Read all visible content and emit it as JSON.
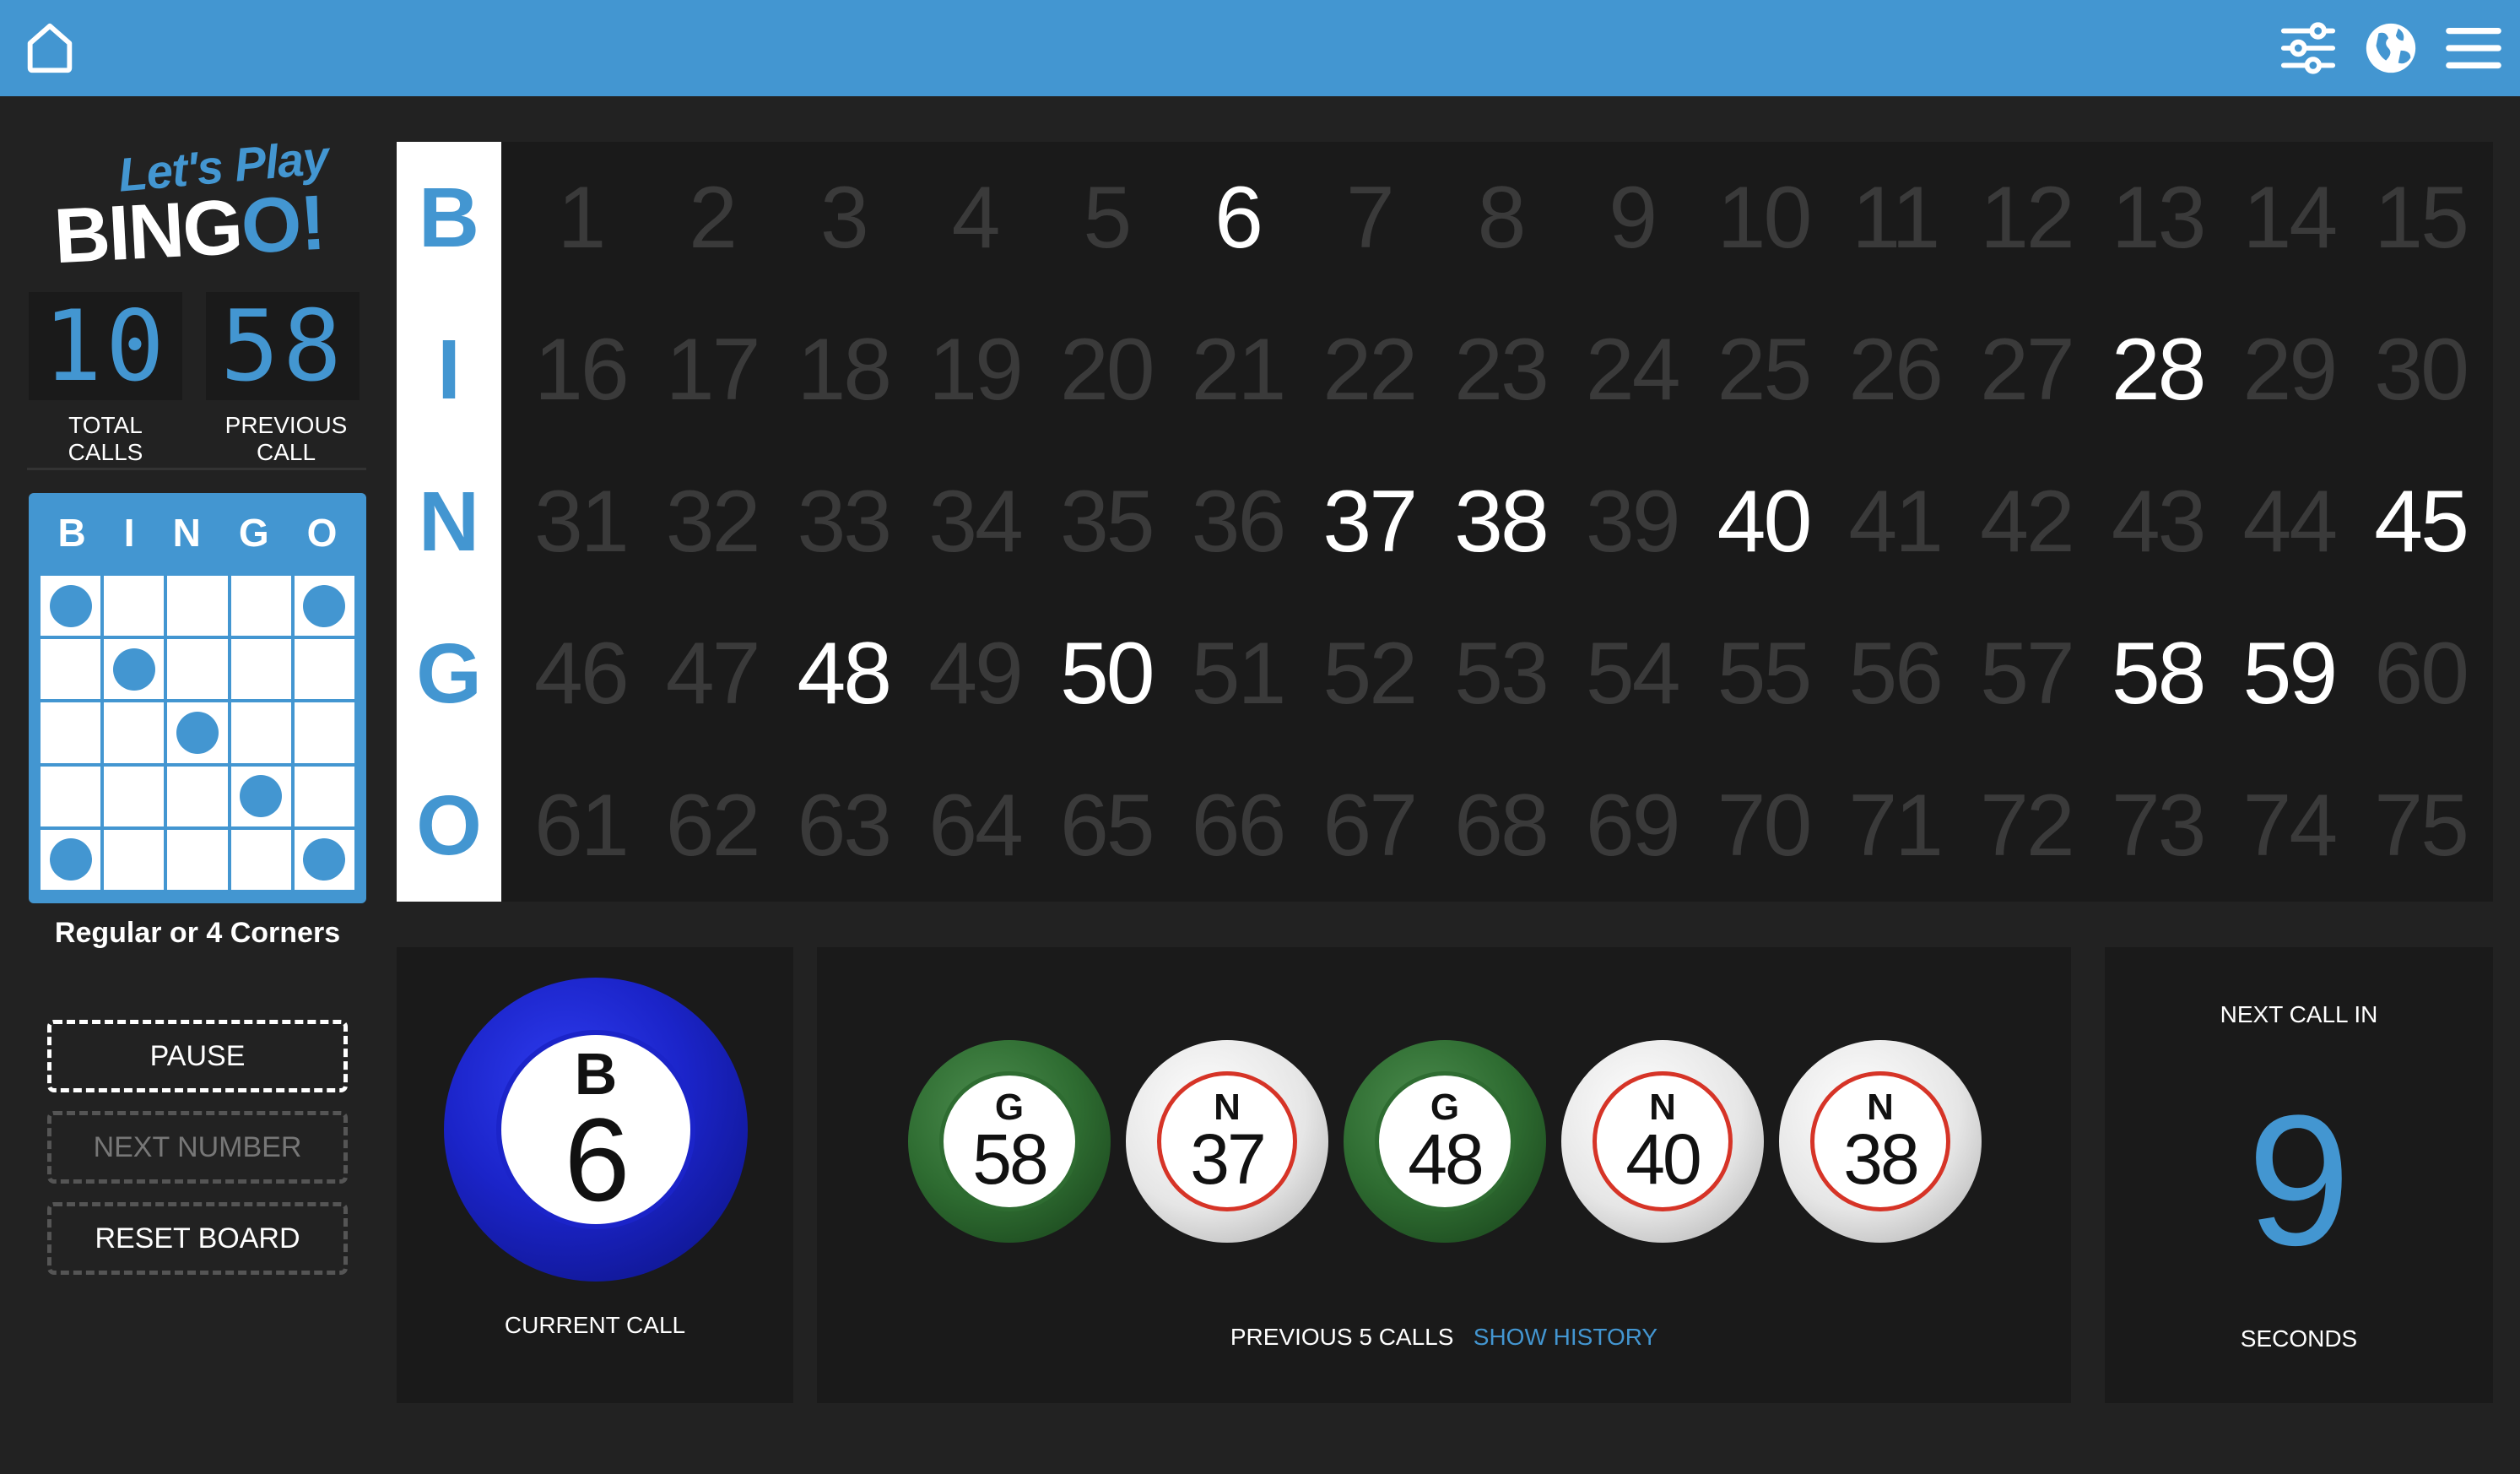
{
  "topbar": {
    "icons": [
      "home-icon",
      "settings-sliders-icon",
      "globe-icon",
      "menu-icon"
    ]
  },
  "logo": {
    "line1": "Let's Play",
    "line2a": "BING",
    "line2b": "O!"
  },
  "stats": {
    "total_calls": "10",
    "total_calls_label": "TOTAL CALLS",
    "previous_call": "58",
    "previous_call_label": "PREVIOUS CALL"
  },
  "pattern": {
    "header": [
      "B",
      "I",
      "N",
      "G",
      "O"
    ],
    "marked": [
      0,
      4,
      6,
      12,
      18,
      20,
      24
    ],
    "name": "Regular or 4 Corners"
  },
  "buttons": {
    "pause": "PAUSE",
    "next_number": "NEXT NUMBER",
    "reset_board": "RESET BOARD"
  },
  "board": {
    "letters": [
      "B",
      "I",
      "N",
      "G",
      "O"
    ],
    "called_numbers": [
      6,
      28,
      37,
      38,
      40,
      45,
      48,
      50,
      58,
      59
    ]
  },
  "current_call": {
    "letter": "B",
    "number": "6",
    "label": "CURRENT CALL"
  },
  "previous_calls": {
    "label": "PREVIOUS 5 CALLS",
    "link": "SHOW HISTORY",
    "balls": [
      {
        "letter": "G",
        "number": "58",
        "color": "green"
      },
      {
        "letter": "N",
        "number": "37",
        "color": "white"
      },
      {
        "letter": "G",
        "number": "48",
        "color": "green"
      },
      {
        "letter": "N",
        "number": "40",
        "color": "white"
      },
      {
        "letter": "N",
        "number": "38",
        "color": "white"
      }
    ]
  },
  "timer": {
    "label": "NEXT CALL IN",
    "value": "9",
    "unit": "SECONDS"
  },
  "colors": {
    "accent": "#4396d1",
    "background": "#222222",
    "board": "#1a1a1a"
  }
}
